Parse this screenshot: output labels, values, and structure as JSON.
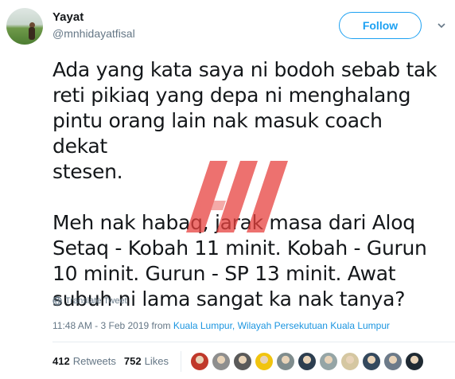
{
  "user": {
    "name": "Yayat",
    "handle": "@mnhidayatfisal"
  },
  "follow_label": "Follow",
  "tweet": {
    "text": "Ada yang kata saya ni bodoh sebab tak\nreti pikiaq yang depa ni menghalang\npintu orang lain nak masuk coach dekat\nstesen.\n\nMeh nak habaq, jarak masa dari Aloq\nSetaq - Kobah 11 minit. Kobah - Gurun\n10 minit. Gurun - SP 13 minit. Awat\nsubuh ni lama sangat ka nak tanya?"
  },
  "translate_label": "Translate Tweet",
  "timestamp": "11:48 AM - 3 Feb 2019 from ",
  "location": "Kuala Lumpur, Wilayah Persekutuan Kuala Lumpur",
  "stats": {
    "retweets_count": "412",
    "retweets_label": "Retweets",
    "likes_count": "752",
    "likes_label": "Likes"
  },
  "colors": {
    "accent": "#1da1f2",
    "watermark": "#e8423f",
    "muted": "#657786"
  },
  "liker_avatar_colors": [
    "#c0392b",
    "#8e8e8e",
    "#5a5a5a",
    "#f1c40f",
    "#7f8c8d",
    "#2c3e50",
    "#95a5a6",
    "#d5c7a1",
    "#34495e",
    "#6c7a89",
    "#1f2a33"
  ]
}
